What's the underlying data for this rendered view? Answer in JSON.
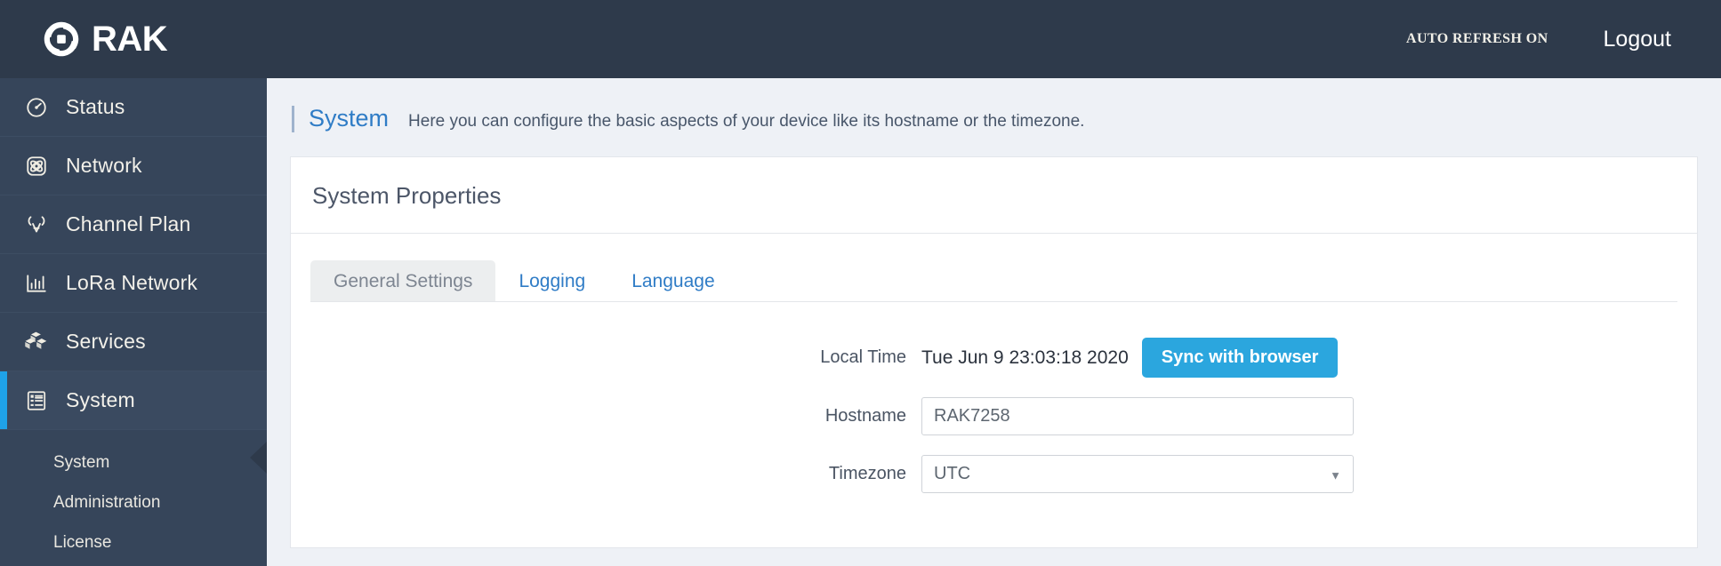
{
  "topbar": {
    "brand": "RAK",
    "logo_icon": "rak-spiral-logo",
    "auto_refresh_label": "AUTO REFRESH ON",
    "logout_label": "Logout"
  },
  "sidebar": {
    "items": [
      {
        "label": "Status",
        "icon": "speedometer-icon",
        "active": false
      },
      {
        "label": "Network",
        "icon": "atom-network-icon",
        "active": false
      },
      {
        "label": "Channel Plan",
        "icon": "antenna-icon",
        "active": false
      },
      {
        "label": "LoRa Network",
        "icon": "bar-chart-icon",
        "active": false
      },
      {
        "label": "Services",
        "icon": "boxes-icon",
        "active": false
      },
      {
        "label": "System",
        "icon": "list-document-icon",
        "active": true
      }
    ],
    "submenu": [
      {
        "label": "System"
      },
      {
        "label": "Administration"
      },
      {
        "label": "License"
      }
    ]
  },
  "page": {
    "title": "System",
    "description": "Here you can configure the basic aspects of your device like its hostname or the timezone."
  },
  "card": {
    "title": "System Properties",
    "tabs": [
      {
        "label": "General Settings",
        "active": true
      },
      {
        "label": "Logging",
        "active": false
      },
      {
        "label": "Language",
        "active": false
      }
    ],
    "form": {
      "local_time_label": "Local Time",
      "local_time_value": "Tue Jun 9 23:03:18 2020",
      "sync_button_label": "Sync with browser",
      "hostname_label": "Hostname",
      "hostname_value": "RAK7258",
      "timezone_label": "Timezone",
      "timezone_value": "UTC",
      "timezone_options": [
        "UTC"
      ]
    }
  },
  "colors": {
    "topbar_bg": "#2e3a4b",
    "sidebar_bg": "#36455a",
    "accent_blue": "#1fa2e8",
    "link_blue": "#2f7cc6",
    "button_blue": "#2ba6de",
    "page_bg": "#eef1f6"
  }
}
